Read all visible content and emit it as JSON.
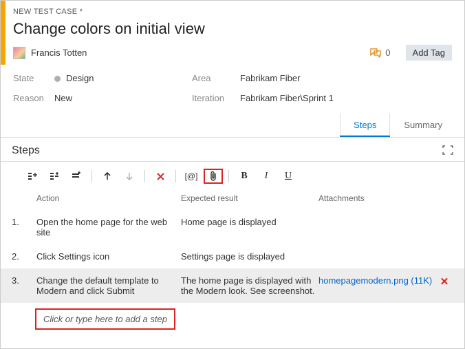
{
  "crumb": "NEW TEST CASE *",
  "title": "Change colors on initial view",
  "assignee": "Francis Totten",
  "comment_count": "0",
  "add_tag_label": "Add Tag",
  "fields": {
    "state_label": "State",
    "state_value": "Design",
    "reason_label": "Reason",
    "reason_value": "New",
    "area_label": "Area",
    "area_value": "Fabrikam Fiber",
    "iteration_label": "Iteration",
    "iteration_value": "Fabrikam Fiber\\Sprint 1"
  },
  "tabs": {
    "steps": "Steps",
    "summary": "Summary"
  },
  "section_title": "Steps",
  "columns": {
    "action": "Action",
    "expected": "Expected result",
    "attachments": "Attachments"
  },
  "rows": [
    {
      "num": "1.",
      "action": "Open the home page for the web site",
      "expected": "Home page is displayed",
      "attachment": ""
    },
    {
      "num": "2.",
      "action": "Click Settings icon",
      "expected": "Settings page is displayed",
      "attachment": ""
    },
    {
      "num": "3.",
      "action": "Change the default template to Modern and click Submit",
      "expected": "The home page is displayed with the Modern look. See screenshot.",
      "attachment": "homepagemodern.png (11K)"
    }
  ],
  "add_step_placeholder": "Click or type here to add a step",
  "toolbar_bold": "B",
  "toolbar_italic": "I",
  "toolbar_underline": "U",
  "toolbar_param": "[@]"
}
